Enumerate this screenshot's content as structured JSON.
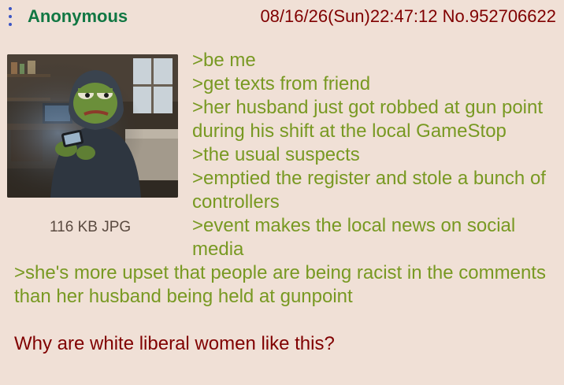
{
  "post": {
    "name": "Anonymous",
    "datetime": "08/16/26(Sun)22:47:12",
    "number": "No.952706622",
    "file_info": "116 KB JPG",
    "thumbnail_icon": "frog-on-phone-image"
  },
  "body_lines": [
    ">be me",
    ">get texts from friend",
    ">her husband just got robbed at gun point during his shift at the local GameStop",
    ">the usual suspects",
    ">emptied the register and stole a bunch of controllers",
    ">event makes the local news on social media",
    ">she's more upset that people are being racist in the comments than her husband being held at gunpoint"
  ],
  "closing_line": "Why are white liberal women like this?",
  "colors": {
    "background": "#f0e0d6",
    "name": "#117743",
    "greentext": "#789922",
    "meta": "#800000"
  }
}
